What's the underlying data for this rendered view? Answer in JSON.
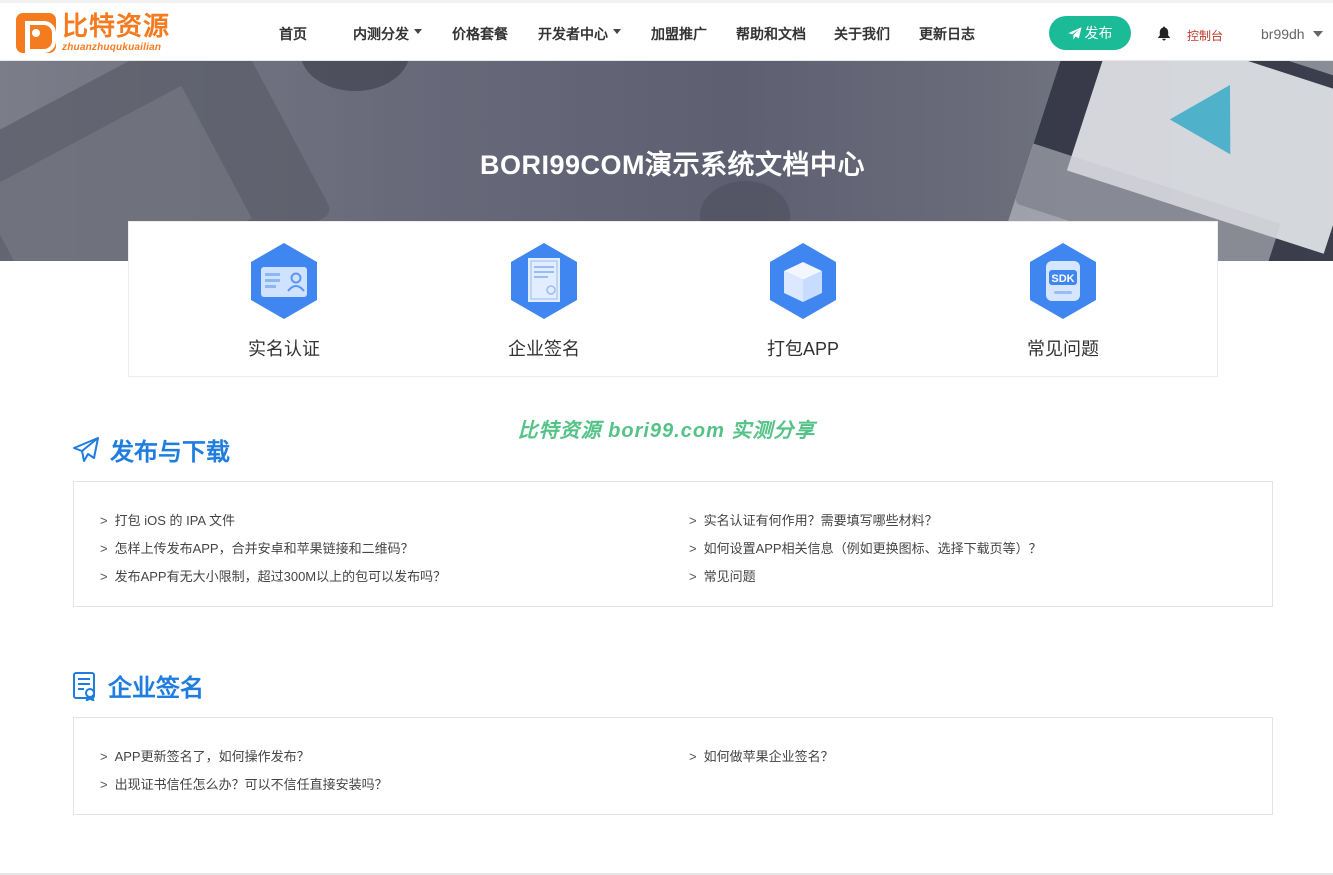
{
  "logo": {
    "name_cn": "比特资源",
    "name_en": "zhuanzhuqukuailian"
  },
  "nav": {
    "items": [
      {
        "label": "首页"
      },
      {
        "label": "内测分发"
      },
      {
        "label": "价格套餐"
      },
      {
        "label": "开发者中心"
      },
      {
        "label": "加盟推广"
      },
      {
        "label": "帮助和文档"
      },
      {
        "label": "关于我们"
      },
      {
        "label": "更新日志"
      }
    ],
    "publish_label": "发布",
    "console_label": "控制台",
    "username": "br99dh"
  },
  "banner": {
    "title": "BORI99COM演示系统文档中心"
  },
  "features": [
    {
      "label": "实名认证",
      "icon": "id-card-icon"
    },
    {
      "label": "企业签名",
      "icon": "certificate-icon"
    },
    {
      "label": "打包APP",
      "icon": "package-box-icon"
    },
    {
      "label": "常见问题",
      "icon": "sdk-icon"
    }
  ],
  "watermark": "比特资源 bori99.com 实测分享",
  "sections": [
    {
      "title": "发布与下载",
      "icon": "paper-plane-icon",
      "links_left": [
        "打包 iOS 的 IPA 文件",
        "怎样上传发布APP，合并安卓和苹果链接和二维码？",
        "发布APP有无大小限制，超过300M以上的包可以发布吗？"
      ],
      "links_right": [
        "实名认证有何作用？需要填写哪些材料？",
        "如何设置APP相关信息（例如更换图标、选择下载页等）？",
        "常见问题"
      ]
    },
    {
      "title": "企业签名",
      "icon": "certificate-doc-icon",
      "links_left": [
        "APP更新签名了，如何操作发布？",
        "出现证书信任怎么办？可以不信任直接安装吗？"
      ],
      "links_right": [
        "如何做苹果企业签名？"
      ]
    }
  ],
  "link_prefix": ">",
  "colors": {
    "brand": "#f47b20",
    "accent": "#1cbb98",
    "link_blue": "#1f7de0",
    "hex_blue": "#3f86f0",
    "watermark": "#55c287"
  }
}
